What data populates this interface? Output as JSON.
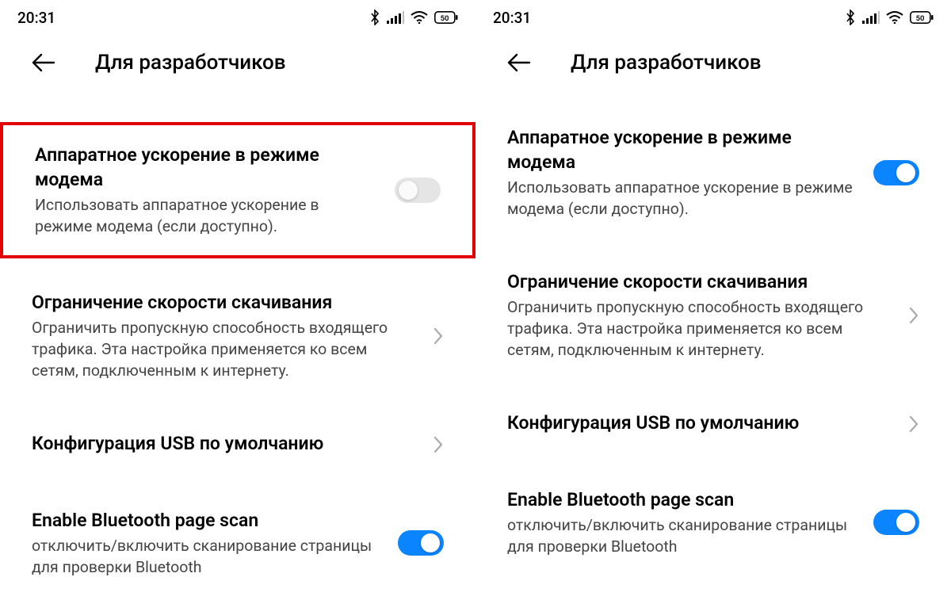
{
  "status": {
    "time": "20:31",
    "battery": "50"
  },
  "header": {
    "title": "Для разработчиков"
  },
  "settings": {
    "hw_accel": {
      "title": "Аппаратное ускорение в режиме модема",
      "desc": "Использовать аппаратное ускорение в режиме модема (если доступно)."
    },
    "dl_limit": {
      "title": "Ограничение скорости скачивания",
      "desc": "Ограничить пропускную способность входящего трафика. Эта настройка применяется ко всем сетям, подключенным к интернету."
    },
    "usb": {
      "title": "Конфигурация USB по умолчанию"
    },
    "bt_scan": {
      "title": "Enable Bluetooth page scan",
      "desc": "отключить/включить сканирование страницы для проверки Bluetooth"
    }
  }
}
